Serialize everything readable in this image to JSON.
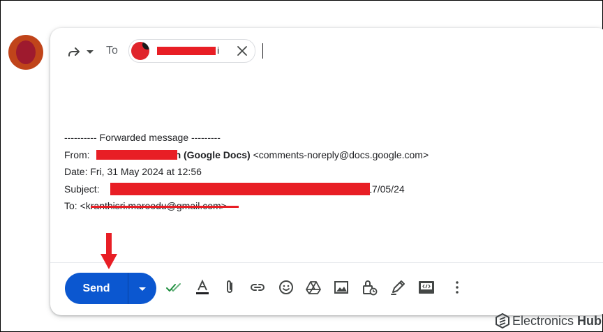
{
  "compose": {
    "to_label": "To",
    "recipient": {
      "name_visible": "i"
    }
  },
  "message": {
    "separator": "---------- Forwarded message ---------",
    "from_label": "From:",
    "from_name_suffix": "n (Google Docs)",
    "from_email": "<comments-noreply@docs.google.com>",
    "date_line": "Date: Fri, 31 May 2024 at 12:56",
    "subject_label": "Subject:",
    "subject_suffix": "- 17/05/24",
    "to_line": "To: <kranthisri.maroodu@gmail.com>"
  },
  "toolbar": {
    "send_label": "Send",
    "icons": [
      "spellcheck-icon",
      "text-format-icon",
      "attach-file-icon",
      "insert-link-icon",
      "emoji-icon",
      "google-drive-icon",
      "insert-photo-icon",
      "confidential-mode-icon",
      "signature-icon",
      "layouts-icon",
      "more-options-icon"
    ]
  },
  "brand": {
    "name": "Electronics",
    "suffix": "Hub"
  },
  "colors": {
    "send_button": "#0b57d0",
    "redaction": "#e81e25",
    "annotation_arrow": "#e81e25",
    "avatar": "#c0441a"
  }
}
